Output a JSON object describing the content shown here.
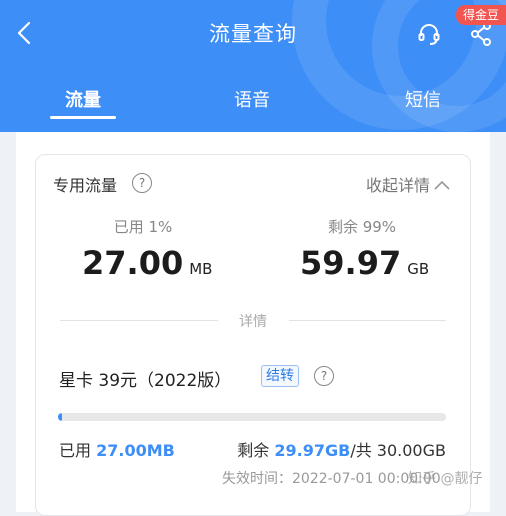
{
  "header": {
    "title": "流量查询",
    "badge": "得金豆",
    "tabs": [
      {
        "label": "流量",
        "active": true
      },
      {
        "label": "语音",
        "active": false
      },
      {
        "label": "短信",
        "active": false
      }
    ],
    "icons": [
      "back-arrow-icon",
      "headset-icon",
      "share-icon"
    ]
  },
  "card": {
    "section_title": "专用流量",
    "help": "?",
    "collapse_label": "收起详情",
    "used_label": "已用 1%",
    "used_value": "27.00",
    "used_unit": "MB",
    "remaining_label": "剩余 99%",
    "remaining_value": "59.97",
    "remaining_unit": "GB",
    "detail_label": "详情"
  },
  "plan": {
    "name": "星卡 39元（2022版）",
    "tag": "结转",
    "help": "?",
    "progress_fraction": 0.01,
    "used_prefix": "已用 ",
    "used_amount": "27.00MB",
    "remain_prefix": "剩余 ",
    "remain_amount": "29.97GB",
    "total": "/共 30.00GB",
    "expiry": "失效时间：2022-07-01 00:00:00"
  },
  "watermark": "知乎 @靓仔",
  "colors": {
    "brand": "#3d8ef7",
    "badge": "#f2544f"
  }
}
